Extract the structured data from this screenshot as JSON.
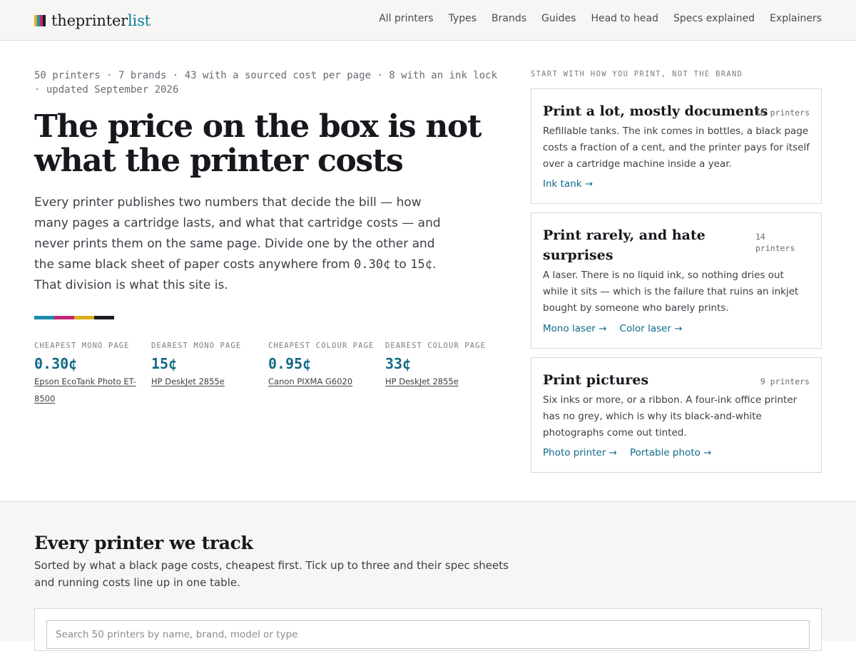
{
  "brand": {
    "name_a": "theprinter",
    "name_b": "list",
    "logo_colors": [
      "#e0b11c",
      "#1f8fb3",
      "#c6236f",
      "#1c1d22"
    ]
  },
  "nav": {
    "items": [
      "All printers",
      "Types",
      "Brands",
      "Guides",
      "Head to head",
      "Specs explained",
      "Explainers"
    ]
  },
  "hero": {
    "meta": "50 printers · 7 brands · 43 with a sourced cost per page · 8 with an ink lock · updated September 2026",
    "title": "The price on the box is not what the printer costs",
    "desc_part1": "Every printer publishes two numbers that decide the bill — how many pages a cartridge lasts, and what that cartridge costs — and never prints them on the same page. Divide one by the other and the same black sheet of paper costs anywhere from ",
    "desc_low": "0.30¢",
    "desc_mid": " to ",
    "desc_high": "15¢",
    "desc_part2": ". That division is what this site is.",
    "bar_colors": [
      "#1a8cad",
      "#c4246f",
      "#dcae18",
      "#1c1d22"
    ]
  },
  "stats": [
    {
      "label": "Cheapest mono page",
      "value": "0.30¢",
      "printer": "Epson EcoTank Photo ET-8500"
    },
    {
      "label": "Dearest mono page",
      "value": "15¢",
      "printer": "HP DeskJet 2855e"
    },
    {
      "label": "Cheapest colour page",
      "value": "0.95¢",
      "printer": "Canon PIXMA G6020"
    },
    {
      "label": "Dearest colour page",
      "value": "33¢",
      "printer": "HP DeskJet 2855e"
    }
  ],
  "aside": {
    "label": "Start with how you print, not the brand",
    "cards": [
      {
        "title": "Print a lot, mostly documents",
        "count": "16 printers",
        "body": "Refillable tanks. The ink comes in bottles, a black page costs a fraction of a cent, and the printer pays for itself over a cartridge machine inside a year.",
        "links": [
          "Ink tank →"
        ]
      },
      {
        "title": "Print rarely, and hate surprises",
        "count_a": "14",
        "count_b": "printers",
        "body": "A laser. There is no liquid ink, so nothing dries out while it sits — which is the failure that ruins an inkjet bought by someone who barely prints.",
        "links": [
          "Mono laser →",
          "Color laser →"
        ]
      },
      {
        "title": "Print pictures",
        "count": "9 printers",
        "body": "Six inks or more, or a ribbon. A four-ink office printer has no grey, which is why its black-and-white photographs come out tinted.",
        "links": [
          "Photo printer →",
          "Portable photo →"
        ]
      }
    ]
  },
  "tracker": {
    "title": "Every printer we track",
    "desc": "Sorted by what a black page costs, cheapest first. Tick up to three and their spec sheets and running costs line up in one table.",
    "search_placeholder": "Search 50 printers by name, brand, model or type"
  }
}
